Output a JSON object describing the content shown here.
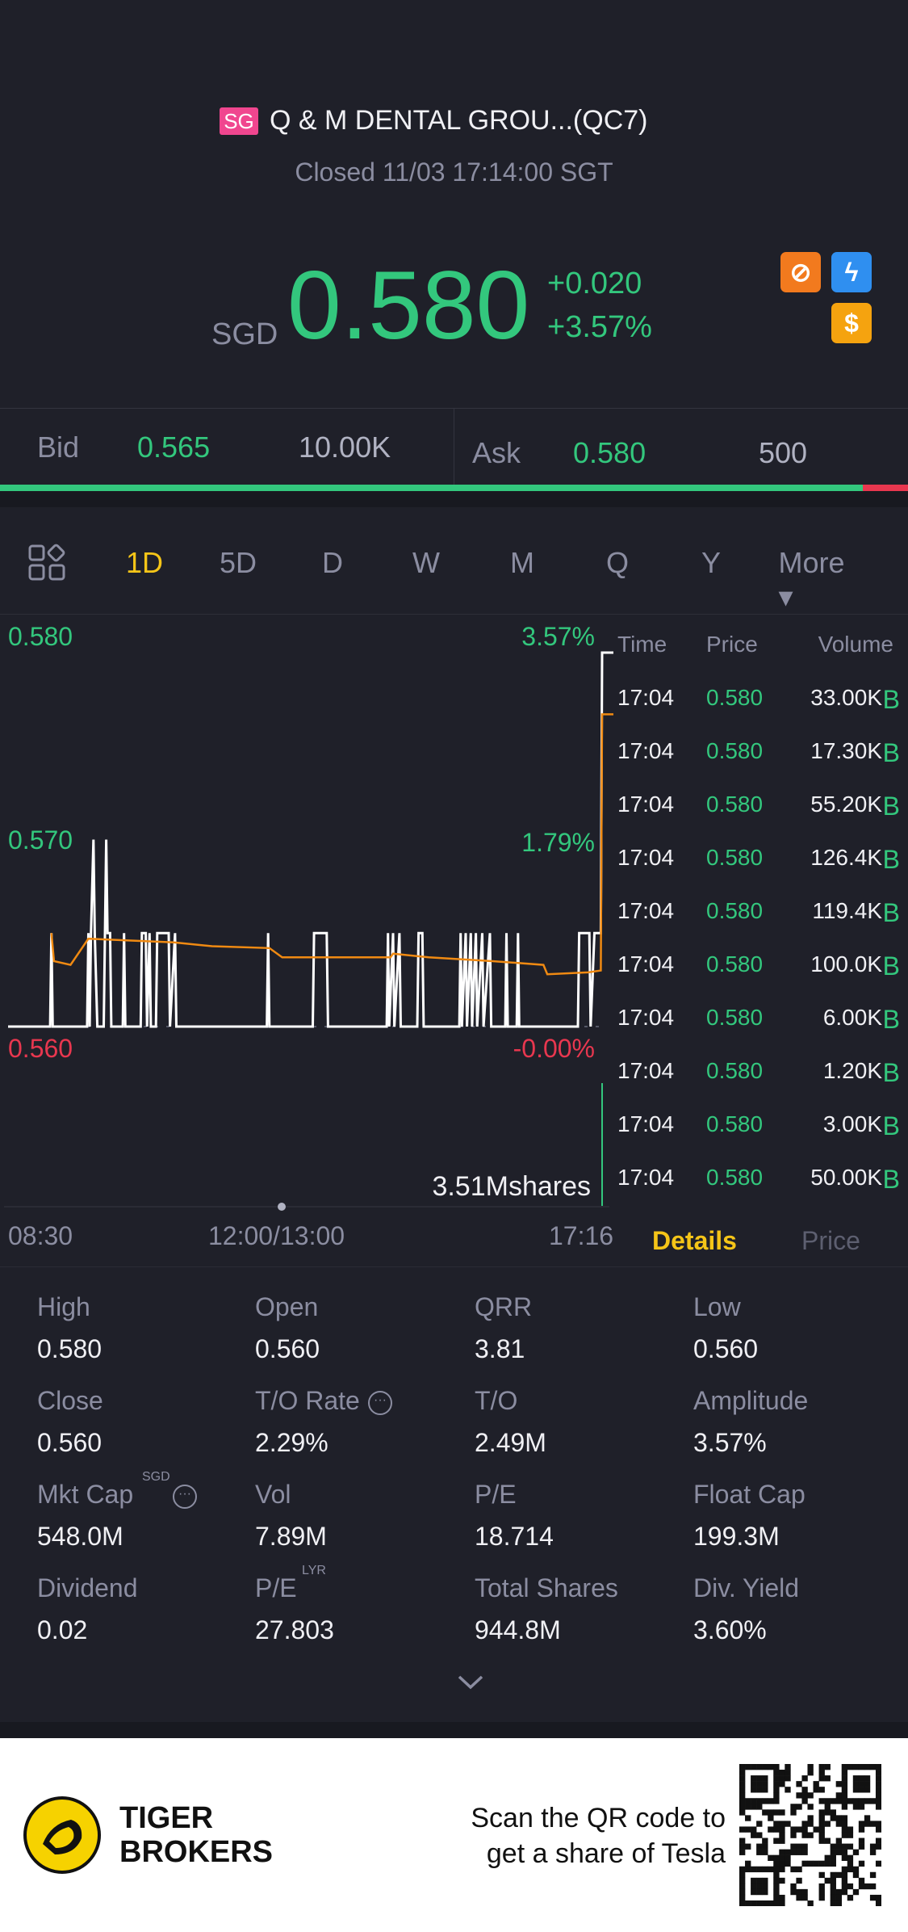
{
  "header": {
    "market_badge": "SG",
    "title": "Q & M DENTAL GROU...(QC7)",
    "status": "Closed 11/03 17:14:00 SGT"
  },
  "quote": {
    "currency": "SGD",
    "price": "0.580",
    "change": "+0.020",
    "change_pct": "+3.57%"
  },
  "icons": [
    "no-short-icon",
    "lightning-icon",
    "dollar-icon"
  ],
  "bidask": {
    "bid_label": "Bid",
    "bid_price": "0.565",
    "bid_size": "10.00K",
    "ask_label": "Ask",
    "ask_price": "0.580",
    "ask_size": "500",
    "bid_ratio": 0.95
  },
  "periods": [
    "1D",
    "5D",
    "D",
    "W",
    "M",
    "Q",
    "Y",
    "More ▾"
  ],
  "active_period": "1D",
  "colors": {
    "up": "#33c77d",
    "down": "#e8374f",
    "accent": "#f5c518",
    "bg": "#1f2029",
    "avg": "#f08a12"
  },
  "chart_data": {
    "type": "line",
    "ylim": [
      0.56,
      0.58
    ],
    "y_ticks_left": [
      "0.580",
      "0.570",
      "0.560"
    ],
    "y_ticks_right": [
      "3.57%",
      "1.79%",
      "-0.00%"
    ],
    "x_ticks": [
      "08:30",
      "12:00/13:00",
      "17:16"
    ],
    "x_range_minutes": [
      0,
      466
    ],
    "volume_label": "3.51Mshares",
    "series": [
      {
        "name": "price",
        "points": [
          [
            0,
            0.56
          ],
          [
            33,
            0.56
          ],
          [
            34,
            0.565
          ],
          [
            35,
            0.56
          ],
          [
            62,
            0.56
          ],
          [
            63,
            0.565
          ],
          [
            64,
            0.56
          ],
          [
            65,
            0.565
          ],
          [
            67,
            0.57
          ],
          [
            68,
            0.565
          ],
          [
            70,
            0.56
          ],
          [
            75,
            0.56
          ],
          [
            77,
            0.57
          ],
          [
            78,
            0.565
          ],
          [
            80,
            0.565
          ],
          [
            81,
            0.56
          ],
          [
            90,
            0.56
          ],
          [
            91,
            0.565
          ],
          [
            92,
            0.56
          ],
          [
            104,
            0.56
          ],
          [
            105,
            0.565
          ],
          [
            108,
            0.565
          ],
          [
            109,
            0.56
          ],
          [
            111,
            0.565
          ],
          [
            112,
            0.56
          ],
          [
            116,
            0.56
          ],
          [
            117,
            0.565
          ],
          [
            126,
            0.565
          ],
          [
            127,
            0.56
          ],
          [
            131,
            0.565
          ],
          [
            132,
            0.56
          ],
          [
            203,
            0.56
          ],
          [
            204,
            0.565
          ],
          [
            205,
            0.56
          ],
          [
            239,
            0.56
          ],
          [
            240,
            0.565
          ],
          [
            250,
            0.565
          ],
          [
            251,
            0.56
          ],
          [
            297,
            0.56
          ],
          [
            298,
            0.565
          ],
          [
            299,
            0.56
          ],
          [
            302,
            0.565
          ],
          [
            303,
            0.56
          ],
          [
            307,
            0.565
          ],
          [
            308,
            0.56
          ],
          [
            321,
            0.56
          ],
          [
            322,
            0.565
          ],
          [
            325,
            0.565
          ],
          [
            326,
            0.56
          ],
          [
            354,
            0.56
          ],
          [
            355,
            0.565
          ],
          [
            356,
            0.56
          ],
          [
            359,
            0.565
          ],
          [
            360,
            0.56
          ],
          [
            363,
            0.565
          ],
          [
            364,
            0.56
          ],
          [
            367,
            0.565
          ],
          [
            368,
            0.56
          ],
          [
            372,
            0.565
          ],
          [
            373,
            0.56
          ],
          [
            378,
            0.565
          ],
          [
            379,
            0.56
          ],
          [
            390,
            0.56
          ],
          [
            391,
            0.565
          ],
          [
            392,
            0.56
          ],
          [
            399,
            0.56
          ],
          [
            400,
            0.565
          ],
          [
            401,
            0.56
          ],
          [
            447,
            0.56
          ],
          [
            448,
            0.565
          ],
          [
            456,
            0.565
          ],
          [
            457,
            0.56
          ],
          [
            460,
            0.565
          ],
          [
            465,
            0.565
          ],
          [
            466,
            0.58
          ]
        ]
      },
      {
        "name": "average",
        "points": [
          [
            34,
            0.565
          ],
          [
            36,
            0.5635
          ],
          [
            49,
            0.5633
          ],
          [
            63,
            0.5647
          ],
          [
            130,
            0.5645
          ],
          [
            160,
            0.5643
          ],
          [
            205,
            0.5642
          ],
          [
            215,
            0.5637
          ],
          [
            300,
            0.5637
          ],
          [
            302,
            0.5639
          ],
          [
            330,
            0.5637
          ],
          [
            380,
            0.5635
          ],
          [
            420,
            0.5633
          ],
          [
            423,
            0.5628
          ],
          [
            455,
            0.5629
          ],
          [
            465,
            0.563
          ],
          [
            466,
            0.5767
          ]
        ]
      }
    ]
  },
  "trades": {
    "headers": [
      "Time",
      "Price",
      "Volume"
    ],
    "rows": [
      {
        "time": "17:04",
        "price": "0.580",
        "volume": "33.00K",
        "side": "B"
      },
      {
        "time": "17:04",
        "price": "0.580",
        "volume": "17.30K",
        "side": "B"
      },
      {
        "time": "17:04",
        "price": "0.580",
        "volume": "55.20K",
        "side": "B"
      },
      {
        "time": "17:04",
        "price": "0.580",
        "volume": "126.4K",
        "side": "B"
      },
      {
        "time": "17:04",
        "price": "0.580",
        "volume": "119.4K",
        "side": "B"
      },
      {
        "time": "17:04",
        "price": "0.580",
        "volume": "100.0K",
        "side": "B"
      },
      {
        "time": "17:04",
        "price": "0.580",
        "volume": "6.00K",
        "side": "B"
      },
      {
        "time": "17:04",
        "price": "0.580",
        "volume": "1.20K",
        "side": "B"
      },
      {
        "time": "17:04",
        "price": "0.580",
        "volume": "3.00K",
        "side": "B"
      },
      {
        "time": "17:04",
        "price": "0.580",
        "volume": "50.00K",
        "side": "B"
      }
    ],
    "tabs": [
      "Details",
      "Price"
    ]
  },
  "stats": [
    {
      "label": "High",
      "value": "0.580"
    },
    {
      "label": "Open",
      "value": "0.560"
    },
    {
      "label": "QRR",
      "value": "3.81"
    },
    {
      "label": "Low",
      "value": "0.560"
    },
    {
      "label": "Close",
      "value": "0.560"
    },
    {
      "label": "T/O Rate",
      "value": "2.29%",
      "info": true
    },
    {
      "label": "T/O",
      "value": "2.49M"
    },
    {
      "label": "Amplitude",
      "value": "3.57%"
    },
    {
      "label": "Mkt Cap",
      "value": "548.0M",
      "sup": "SGD",
      "info": true
    },
    {
      "label": "Vol",
      "value": "7.89M"
    },
    {
      "label": "P/E",
      "value": "18.714"
    },
    {
      "label": "Float Cap",
      "value": "199.3M"
    },
    {
      "label": "Dividend",
      "value": "0.02"
    },
    {
      "label": "P/E",
      "value": "27.803",
      "sup": "LYR"
    },
    {
      "label": "Total Shares",
      "value": "944.8M"
    },
    {
      "label": "Div. Yield",
      "value": "3.60%"
    }
  ],
  "footer": {
    "brand_line1": "TIGER",
    "brand_line2": "BROKERS",
    "promo_line1": "Scan the QR code to",
    "promo_line2": "get a share of Tesla"
  }
}
